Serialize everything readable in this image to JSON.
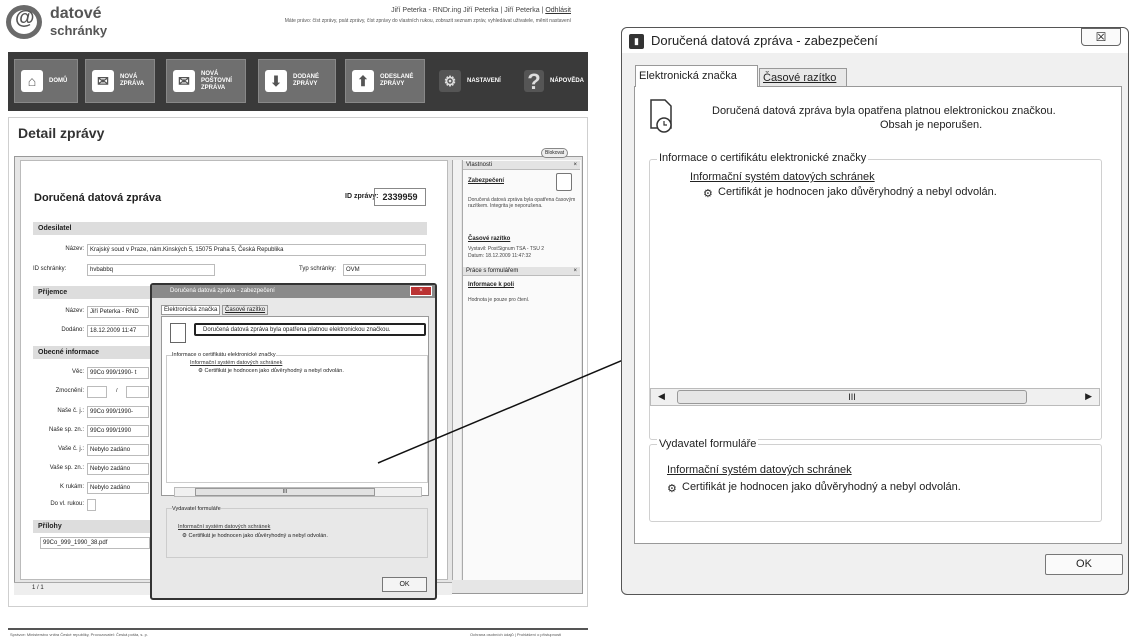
{
  "header": {
    "logo_top": "datové",
    "logo_bottom": "schránky",
    "user_line": "Jiří Peterka - RNDr.ing Jiří Peterka | Jiří Peterka | ",
    "logout": "Odhlásit",
    "rights_line": "Máte právo: číst zprávy, psát zprávy, číst zprávy do vlastních rukou, zobrazit seznam zpráv, vyhledávat uživatele, měnit nastavení"
  },
  "nav": [
    {
      "label": "DOMŮ"
    },
    {
      "label": "NOVÁ ZPRÁVA"
    },
    {
      "label": "NOVÁ POŠTOVNÍ ZPRÁVA"
    },
    {
      "label": "DODANÉ ZPRÁVY"
    },
    {
      "label": "ODESLANÉ ZPRÁVY"
    },
    {
      "label": "NASTAVENÍ"
    },
    {
      "label": "NÁPOVĚDA"
    }
  ],
  "detail": {
    "title": "Detail zprávy",
    "blokovat": "Blokovat",
    "doc_heading": "Doručená datová zpráva",
    "id_label": "ID zprávy:",
    "id_value": "2339959",
    "sections": {
      "odesilatel": "Odesilatel",
      "prijemce": "Příjemce",
      "obecne": "Obecné informace",
      "prilohy": "Přílohy"
    },
    "fields": {
      "nazev_label": "Název:",
      "nazev_value": "Krajský soud v Praze, nám.Kinských 5, 15075 Praha 5, Česká Republika",
      "id_schranky_label": "ID schránky:",
      "id_schranky_value": "hvbabbq",
      "typ_label": "Typ schránky:",
      "typ_value": "OVM",
      "prij_nazev_value": "Jiří Peterka - RND",
      "dodano_label": "Dodáno:",
      "dodano_value": "18.12.2009 11:47",
      "vec_label": "Věc:",
      "vec_value": "99Co 999/1990- t",
      "zmocneni_label": "Zmocnění:",
      "zmocneni_sep": "/",
      "nase_cj_label": "Naše č. j.:",
      "nase_cj_value": "99Co 999/1990-",
      "nase_spzn_label": "Naše sp. zn.:",
      "nase_spzn_value": "99Co 999/1990",
      "vase_cj_label": "Vaše č. j.:",
      "vase_cj_value": "Nebylo zadáno",
      "vase_spzn_label": "Vaše sp. zn.:",
      "vase_spzn_value": "Nebylo zadáno",
      "krukam_label": "K rukám:",
      "krukam_value": "Nebylo zadáno",
      "dovlrukou_label": "Do vl. rukou:",
      "attachment": "99Co_999_1990_38.pdf"
    },
    "page_indicator": "1 / 1"
  },
  "properties": {
    "vlastnosti": "Vlastnosti",
    "zabezpeceni": "Zabezpečení",
    "zab_text": "Doručená datová zpráva byla opatřena časovým razítkem. Integrita je neporušena.",
    "casove_razitko": "Časové razítko",
    "vystavil": "Vystavil: PostSignum TSA - TSU 2",
    "datum": "Datum: 18.12.2009 11:47:32",
    "prace": "Práce s formulářem",
    "info_poli": "Informace k poli",
    "hodnota": "Hodnota je pouze pro čtení."
  },
  "footer": {
    "left": "Správce: Ministerstvo vnitra České republiky, Provozovatel: Česká pošta, s. p.",
    "right": "Ochrana osobních údajů | Prohlášení o přístupnosti"
  },
  "small_dialog": {
    "title": "Doručená datová zpráva - zabezpečení",
    "tab1": "Elektronická značka",
    "tab2": "Časové razítko",
    "message": "Doručená datová zpráva byla opatřena platnou elektronickou značkou.",
    "group1": "Informace o certifikátu elektronické značky",
    "link": "Informační systém datových schránek",
    "cert": "Certifikát je hodnocen jako důvěryhodný a nebyl odvolán.",
    "scroll_thumb": "III",
    "group2": "Vydavatel formuláře",
    "ok": "OK"
  },
  "big_dialog": {
    "title": "Doručená datová zpráva - zabezpečení",
    "close": "☒",
    "tab1": "Elektronická značka",
    "tab2": "Časové razítko",
    "message1": "Doručená datová zpráva byla opatřena platnou elektronickou značkou.",
    "message2": "Obsah je neporušen.",
    "group1": "Informace o certifikátu elektronické značky",
    "link": "Informační systém datových schránek",
    "cert": "Certifikát je hodnocen jako důvěryhodný a nebyl odvolán.",
    "scroll_thumb": "III",
    "group2": "Vydavatel formuláře",
    "ok": "OK"
  },
  "colors": {
    "nav_bg": "#3a3a3a",
    "nav_button": "#6f6f6f"
  }
}
